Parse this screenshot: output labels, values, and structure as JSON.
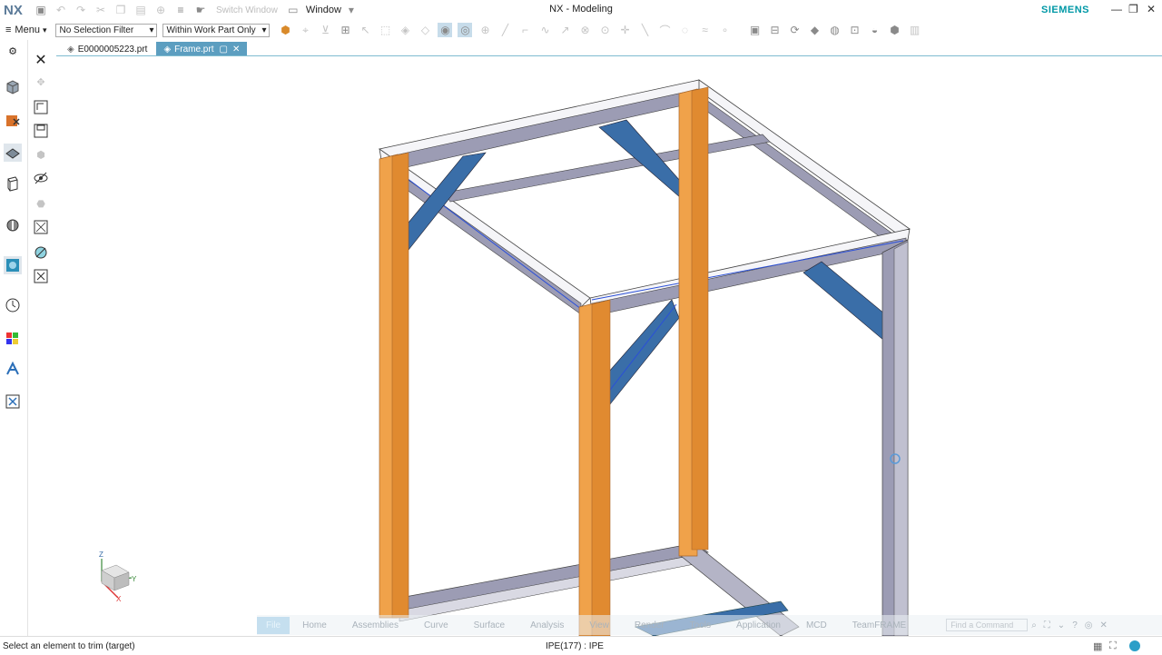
{
  "app": {
    "logo": "NX",
    "title": "NX - Modeling",
    "brand": "SIEMENS",
    "brand_color": "#0098a6",
    "accent_color": "#5c9ec0"
  },
  "titlebar": {
    "switch_window_label": "Switch Window",
    "window_menu_label": "Window"
  },
  "toolbar": {
    "menu_label": "Menu",
    "selection_filter": "No Selection Filter",
    "selection_scope": "Within Work Part Only"
  },
  "tabs": [
    {
      "label": "E0000005223.prt",
      "active": false
    },
    {
      "label": "Frame.prt",
      "active": true
    }
  ],
  "ribbon": {
    "tabs": [
      "File",
      "Home",
      "Assemblies",
      "Curve",
      "Surface",
      "Analysis",
      "View",
      "Render",
      "Tools",
      "Application",
      "MCD",
      "TeamFRAME"
    ],
    "find_command_placeholder": "Find a Command"
  },
  "triad": {
    "z": "Z",
    "y": "Y",
    "x": "X"
  },
  "status": {
    "prompt": "Select an element to trim (target)",
    "selection_info": "IPE(177) : IPE"
  },
  "colors": {
    "beam_gray": "#9c9cb4",
    "brace_blue": "#3a6ea8",
    "column_orange": "#f0a24a"
  }
}
